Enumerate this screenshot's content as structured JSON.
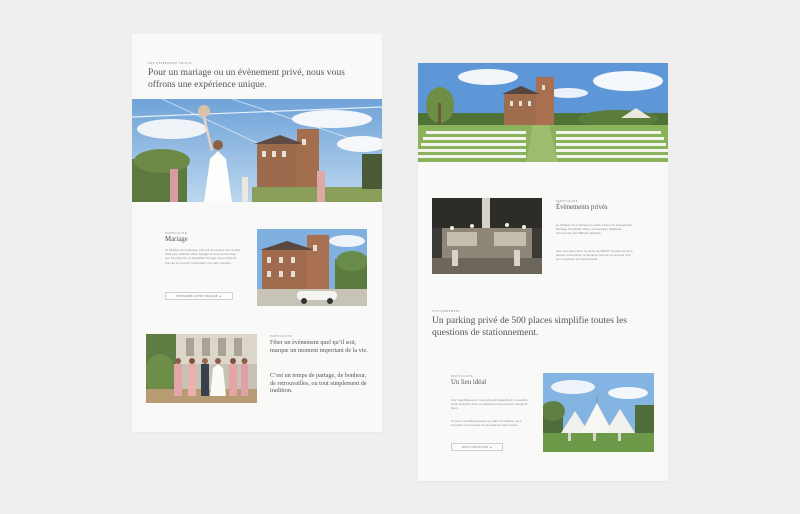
{
  "left": {
    "intro": {
      "eyebrow": "Une expérience unique",
      "title": "Pour un mariage ou un évènement privé, nous vous offrons une expérience unique."
    },
    "mariage": {
      "eyebrow": "Particulier",
      "title": "Mariage",
      "text": "Le Château de la Sarlaye, entouré de verdure vert le lieux idéal pour célébrer votre mariage et vivre le plus beau jour de votre vie. La possibilité de loger vos proches et prendre en charge l’organisation de votre mariage.",
      "button": "Demander votre mariage",
      "button_arrow": "▸"
    },
    "feter": {
      "eyebrow": "Particulier",
      "title": "Fêter un évènement quel qu’il soit, marque un moment important de la vie.",
      "text": "C’est un temps de partage, de bonheur, de retrouvailles, ou tout simplement de tradition."
    }
  },
  "right": {
    "evenements": {
      "eyebrow": "Particulier",
      "title": "Évènements privés",
      "text1": "Le Château de la Sarlaye accueille à tous vos évènements : Mariage, Fiançailles, Baby, Anniversaire, Baptême, Communion, Bar Mitzvah, Retraite.",
      "text2": "Avec une pièce libre, un jardin de 5000m² de pelouse et un Pavillon sans piliers, le domaine vous et vos proches hors pour organiser vos évènements."
    },
    "parking": {
      "eyebrow": "Stationnement",
      "title": "Un parking privé de 500 places simplifie toutes les questions de stationnement."
    },
    "lieu": {
      "eyebrow": "Particulier",
      "title": "Un lieu idéal",
      "text1": "Une magnifique pour vous accueillir également un pavillon, votre réception dans un superbe environnement naturel et fleuri.",
      "text2": "Un tout, nos hébergements au cœur du Château, pour accueillir vos convives et s’envolez de votre soirée.",
      "button": "Nous contacter",
      "button_arrow": "▸"
    }
  }
}
